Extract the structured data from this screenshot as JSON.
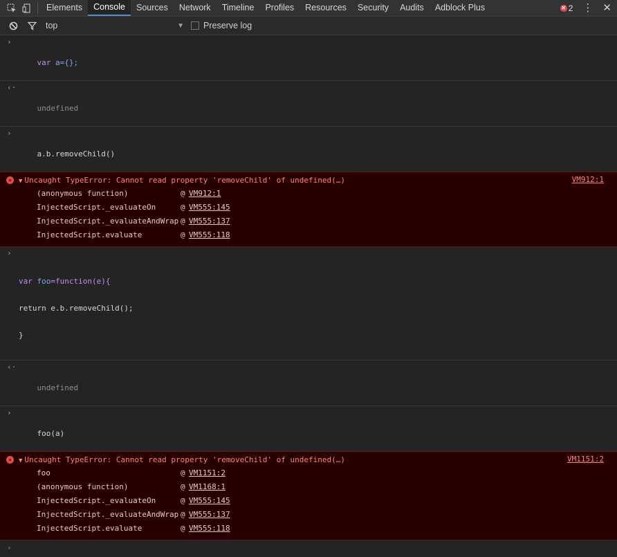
{
  "toolbar": {
    "tabs": [
      "Elements",
      "Console",
      "Sources",
      "Network",
      "Timeline",
      "Profiles",
      "Resources",
      "Security",
      "Audits",
      "Adblock Plus"
    ],
    "active_tab": "Console",
    "error_count": "2",
    "kebab": "⋮",
    "close": "✕"
  },
  "filter": {
    "context": "top",
    "preserve_log_label": "Preserve log"
  },
  "console": {
    "cmd1": {
      "p1": "var",
      "p2": " a={};"
    },
    "res1": "undefined",
    "cmd2": {
      "p1": "a.b.removeChild()"
    },
    "error1": {
      "message": "Uncaught TypeError: Cannot read property 'removeChild' of undefined(…)",
      "source": "VM912:1",
      "frames": [
        {
          "name": "(anonymous function)",
          "loc": "VM912:1"
        },
        {
          "name": "InjectedScript._evaluateOn",
          "loc": "VM555:145"
        },
        {
          "name": "InjectedScript._evaluateAndWrap",
          "loc": "VM555:137"
        },
        {
          "name": "InjectedScript.evaluate",
          "loc": "VM555:118"
        }
      ]
    },
    "cmd3": {
      "line1a": "var",
      "line1b": " foo",
      "line1c": "=function(e){",
      "line2": "return e.b.removeChild();",
      "line3": "}"
    },
    "res2": "undefined",
    "cmd4": "foo(a)",
    "error2": {
      "message": "Uncaught TypeError: Cannot read property 'removeChild' of undefined(…)",
      "source": "VM1151:2",
      "frames": [
        {
          "name": "foo",
          "loc": "VM1151:2"
        },
        {
          "name": "(anonymous function)",
          "loc": "VM1168:1"
        },
        {
          "name": "InjectedScript._evaluateOn",
          "loc": "VM555:145"
        },
        {
          "name": "InjectedScript._evaluateAndWrap",
          "loc": "VM555:137"
        },
        {
          "name": "InjectedScript.evaluate",
          "loc": "VM555:118"
        }
      ]
    },
    "at_symbol": "@"
  },
  "glyphs": {
    "input": "›",
    "output": "‹·",
    "error": "✕",
    "triangle": "▼"
  }
}
